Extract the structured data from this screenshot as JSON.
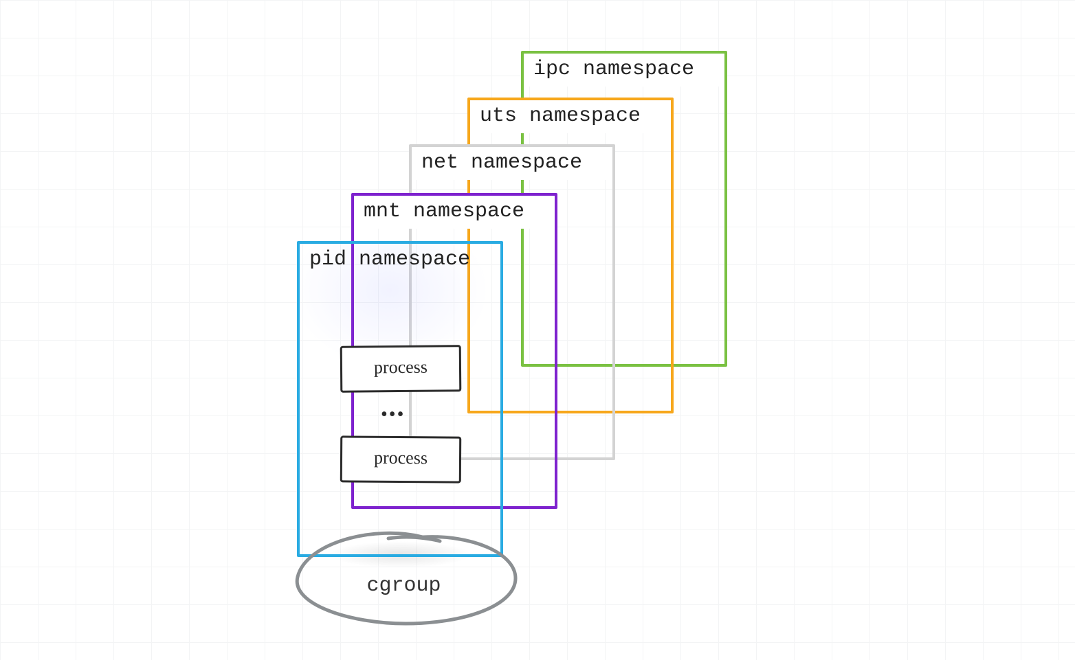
{
  "namespaces": {
    "ipc": {
      "label": "ipc namespace",
      "color": "#7ac142"
    },
    "uts": {
      "label": "uts namespace",
      "color": "#f7a71b"
    },
    "net": {
      "label": "net namespace",
      "color": "#d3d3d3"
    },
    "mnt": {
      "label": "mnt namespace",
      "color": "#7e22ce"
    },
    "pid": {
      "label": "pid namespace",
      "color": "#29abe2"
    }
  },
  "processes": {
    "box1": "process",
    "box2": "process",
    "ellipsis": "•••"
  },
  "cgroup": {
    "label": "cgroup",
    "stroke": "#8b8f92"
  }
}
